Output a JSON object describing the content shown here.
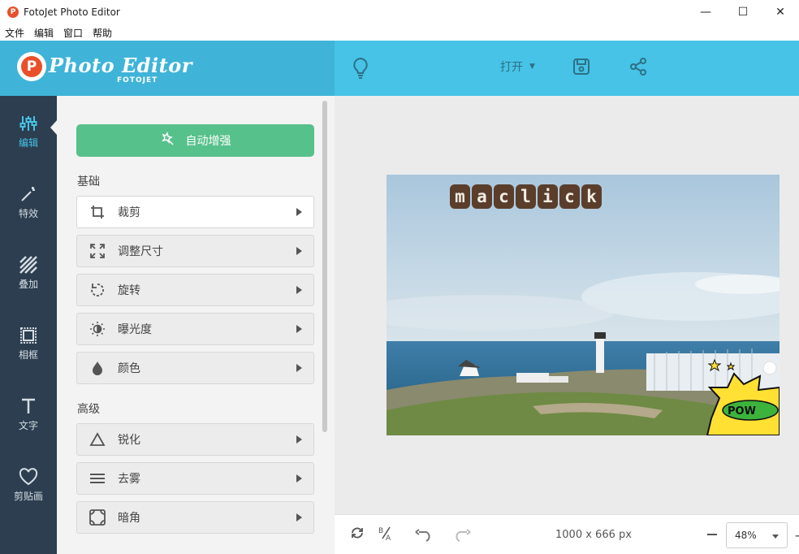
{
  "window": {
    "title": "FotoJet Photo Editor",
    "controls": [
      "—",
      "☐",
      "✕"
    ]
  },
  "menu": [
    "文件",
    "编辑",
    "窗口",
    "帮助"
  ],
  "header": {
    "logo_text": "Photo Editor",
    "logo_sub": "FOTOJET",
    "open_label": "打开",
    "icons": [
      "lightbulb-icon",
      "save-icon",
      "share-icon"
    ],
    "colors": {
      "left": "#3fb4d8",
      "right": "#46c3e6"
    }
  },
  "nav": [
    {
      "label": "编辑",
      "icon": "sliders-icon",
      "active": true
    },
    {
      "label": "特效",
      "icon": "magic-wand-icon",
      "active": false
    },
    {
      "label": "叠加",
      "icon": "hatch-icon",
      "active": false
    },
    {
      "label": "相框",
      "icon": "frame-icon",
      "active": false
    },
    {
      "label": "文字",
      "icon": "text-icon",
      "active": false
    },
    {
      "label": "剪贴画",
      "icon": "heart-icon",
      "active": false
    }
  ],
  "panel": {
    "auto_button": "自动增强",
    "basic_label": "基础",
    "basic_tools": [
      {
        "label": "裁剪",
        "icon": "crop-icon"
      },
      {
        "label": "调整尺寸",
        "icon": "resize-icon"
      },
      {
        "label": "旋转",
        "icon": "rotate-icon"
      },
      {
        "label": "曝光度",
        "icon": "exposure-icon"
      },
      {
        "label": "颜色",
        "icon": "droplet-icon"
      }
    ],
    "advanced_label": "高级",
    "advanced_tools": [
      {
        "label": "锐化",
        "icon": "triangle-icon"
      },
      {
        "label": "去雾",
        "icon": "lines-icon"
      },
      {
        "label": "暗角",
        "icon": "vignette-icon"
      }
    ]
  },
  "canvas": {
    "watermark": "maclick"
  },
  "bottom": {
    "dimensions": "1000 x 666 px",
    "zoom": "48%"
  }
}
